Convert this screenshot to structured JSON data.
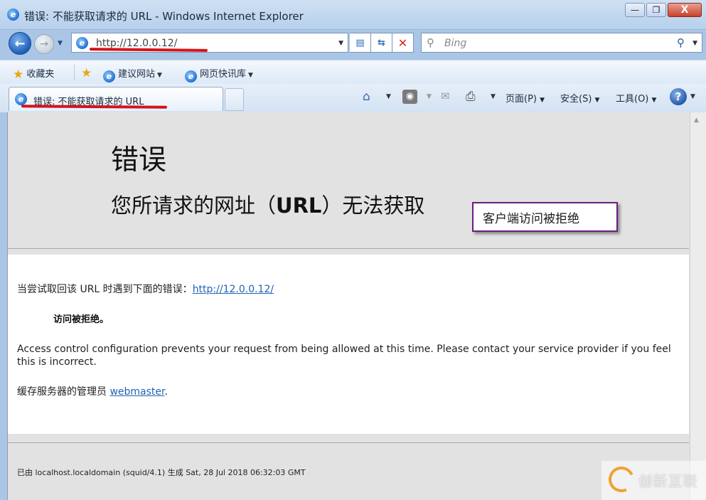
{
  "window": {
    "title": "错误: 不能获取请求的 URL - Windows Internet Explorer",
    "minimize": "—",
    "maximize": "❐",
    "close": "X"
  },
  "nav": {
    "back": "←",
    "forward": "→",
    "address": "http://12.0.0.12/",
    "search_placeholder": "Bing"
  },
  "favorites": {
    "favorites_label": "收藏夹",
    "items": [
      {
        "label": "建议网站"
      },
      {
        "label": "网页快讯库"
      }
    ]
  },
  "tabs": [
    {
      "label": "错误: 不能获取请求的 URL"
    }
  ],
  "commandbar": {
    "page": "页面(P)",
    "safety": "安全(S)",
    "tools": "工具(O)",
    "help": "?"
  },
  "page": {
    "heading": "错误",
    "subheading_prefix": "您所请求的网址（",
    "subheading_url": "URL",
    "subheading_suffix": "）无法获取",
    "retrieve_text": "当尝试取回该  URL 时遇到下面的错误：",
    "retrieve_link": "http://12.0.0.12/",
    "denied": "访问被拒绝。",
    "explanation": "Access control configuration prevents your request from being allowed at this time. Please contact your service provider if you feel this is incorrect.",
    "admin_text": "缓存服务器的管理员 ",
    "admin_link": "webmaster",
    "admin_end": ".",
    "footer": "已由 localhost.localdomain (squid/4.1) 生成 Sat, 28 Jul 2018 06:32:03 GMT"
  },
  "annotation": {
    "callout": "客户端访问被拒绝"
  },
  "watermark": {
    "text": "创新互联"
  },
  "colors": {
    "link": "#1f63b6",
    "annotation_red": "#d4141a",
    "callout_border": "#6b1e80"
  }
}
